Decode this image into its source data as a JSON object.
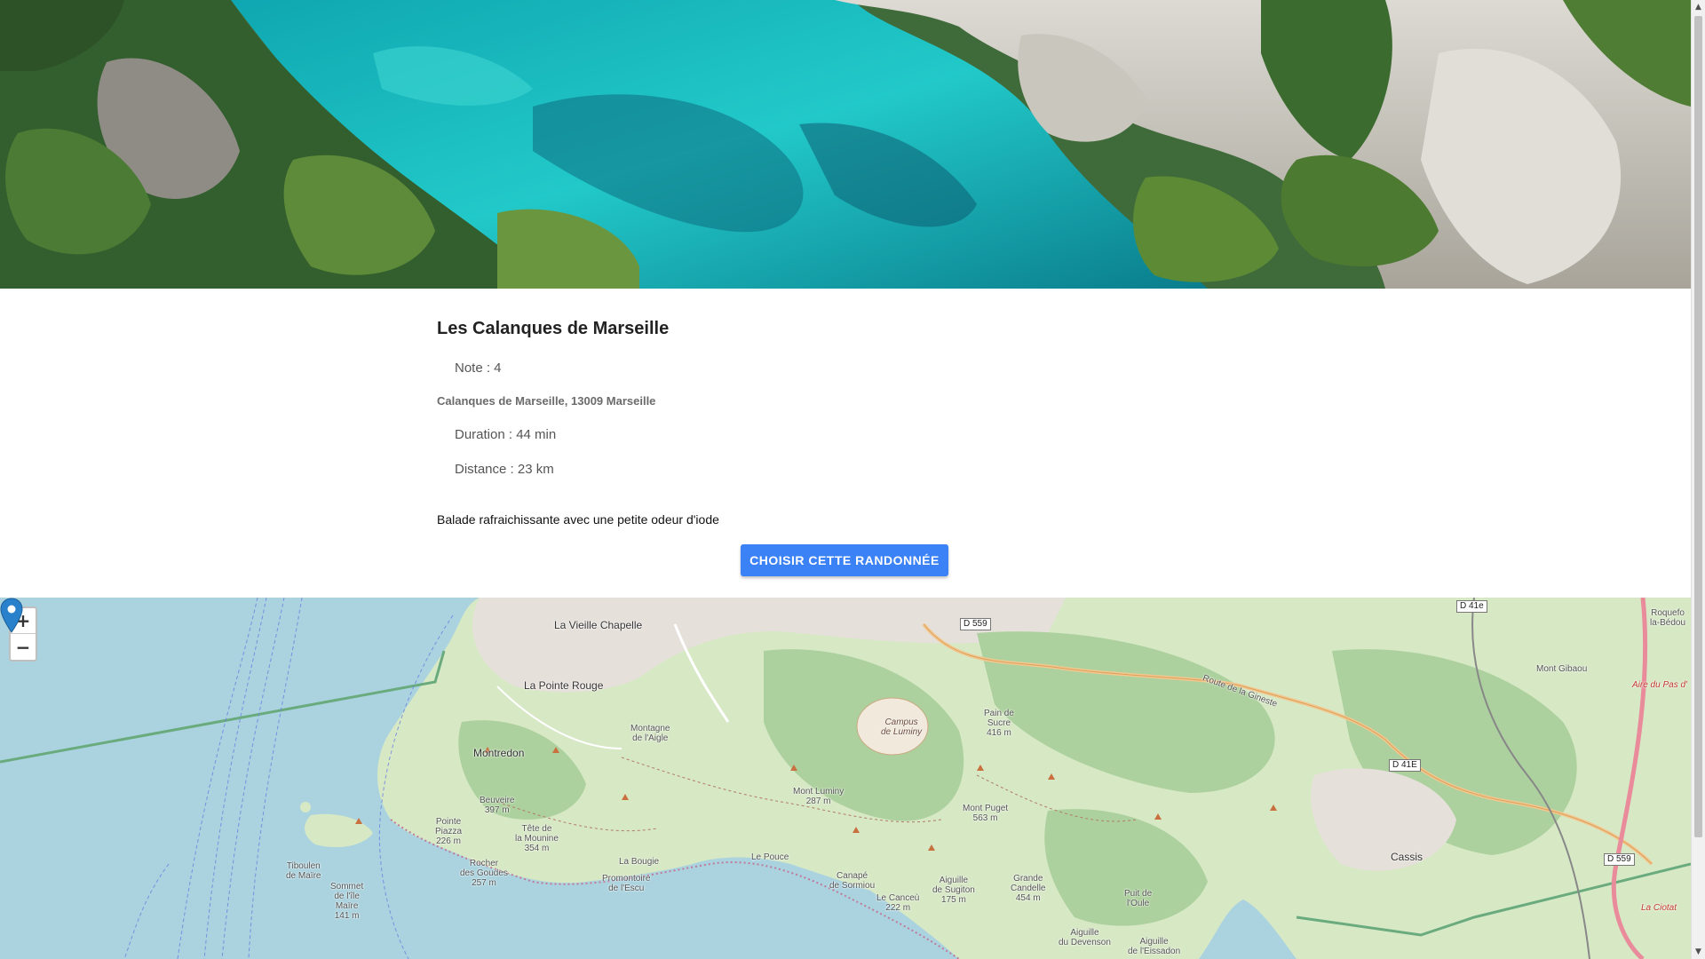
{
  "hike": {
    "title": "Les Calanques de Marseille",
    "note": "Note : 4",
    "address": "Calanques de Marseille, 13009 Marseille",
    "duration": "Duration : 44 min",
    "distance": "Distance : 23 km",
    "description": "Balade rafraichissante avec une petite odeur d'iode",
    "choose_label": "CHOISIR CETTE RANDONNÉE"
  },
  "map": {
    "zoom_in": "+",
    "zoom_out": "−",
    "places": {
      "vieille_chapelle": "La Vieille Chapelle",
      "pointe_rouge": "La Pointe Rouge",
      "montredon": "Montredon",
      "montagne_aigle": "Montagne\nde l'Aigle",
      "campus": "Campus\nde Luminy",
      "pain_sucre": "Pain de\nSucre\n416 m",
      "mont_luminy": "Mont Luminy\n287 m",
      "mont_puget": "Mont Puget\n563 m",
      "beuveire": "Beuveire\n397 m",
      "pointe_piazza": "Pointe\nPiazza\n226 m",
      "tete_mounine": "Tête de\nla Mounine\n354 m",
      "rocher_goudes": "Rocher\ndes Goudes\n257 m",
      "tiboulen": "Tiboulen\nde Maïre",
      "sommet_maire": "Sommet\nde l'île\nMaïre\n141 m",
      "le_pouce": "Le Pouce",
      "la_bougie": "La Bougie",
      "promontoire": "Promontoire\nde l'Escu",
      "canape": "Canapé\nde Sormiou",
      "aiguille_sugiton": "Aiguille\nde Sugiton\n175 m",
      "canceu": "Le Canceù\n222 m",
      "grande_candelle": "Grande\nCandelle\n454 m",
      "puit_oule": "Puit de\nl'Oule",
      "aiguille_devenson": "Aiguille\ndu Devenson",
      "aiguille_eissadon": "Aiguille\nde l'Eissadon",
      "cassis": "Cassis",
      "mont_gibaou": "Mont Gibaou",
      "roquefort": "Roquefo\nla-Bédou",
      "aire_pas": "Aire du Pas d'",
      "route_gineste": "Route de la Gineste",
      "la_ciotat": "La Ciotat"
    },
    "roads": {
      "d559_top": "D 559",
      "d41e_top": "D 41e",
      "d41e": "D 41E",
      "d559_right": "D 559"
    },
    "colors": {
      "sea": "#aad3df",
      "land": "#d7e8c5",
      "urban": "#e6e0da",
      "forest": "#add19e",
      "marker": "#2a81cb",
      "button": "#3b82f6"
    }
  }
}
